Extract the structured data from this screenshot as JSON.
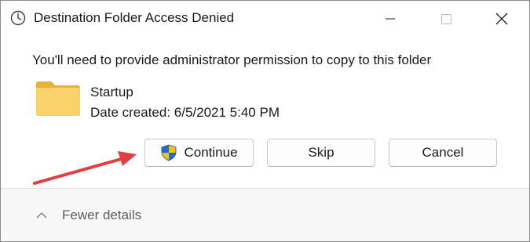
{
  "window": {
    "title": "Destination Folder Access Denied",
    "title_icon": "clock-icon",
    "controls": [
      "minimize-icon",
      "maximize-icon",
      "close-icon"
    ]
  },
  "dialog": {
    "message": "You'll need to provide administrator permission to copy to this folder",
    "item": {
      "icon": "folder-icon",
      "name": "Startup",
      "date_created": "Date created: 6/5/2021 5:40 PM"
    }
  },
  "buttons": {
    "continue_label": "Continue",
    "continue_icon": "uac-shield-icon",
    "skip_label": "Skip",
    "cancel_label": "Cancel"
  },
  "footer": {
    "details_label": "Fewer details",
    "details_icon": "chevron-up-icon"
  },
  "colors": {
    "annotation_arrow": "#e0403f",
    "folder": "#f7c948",
    "shield_blue": "#1f6fc6",
    "shield_yellow": "#f4c20d"
  }
}
